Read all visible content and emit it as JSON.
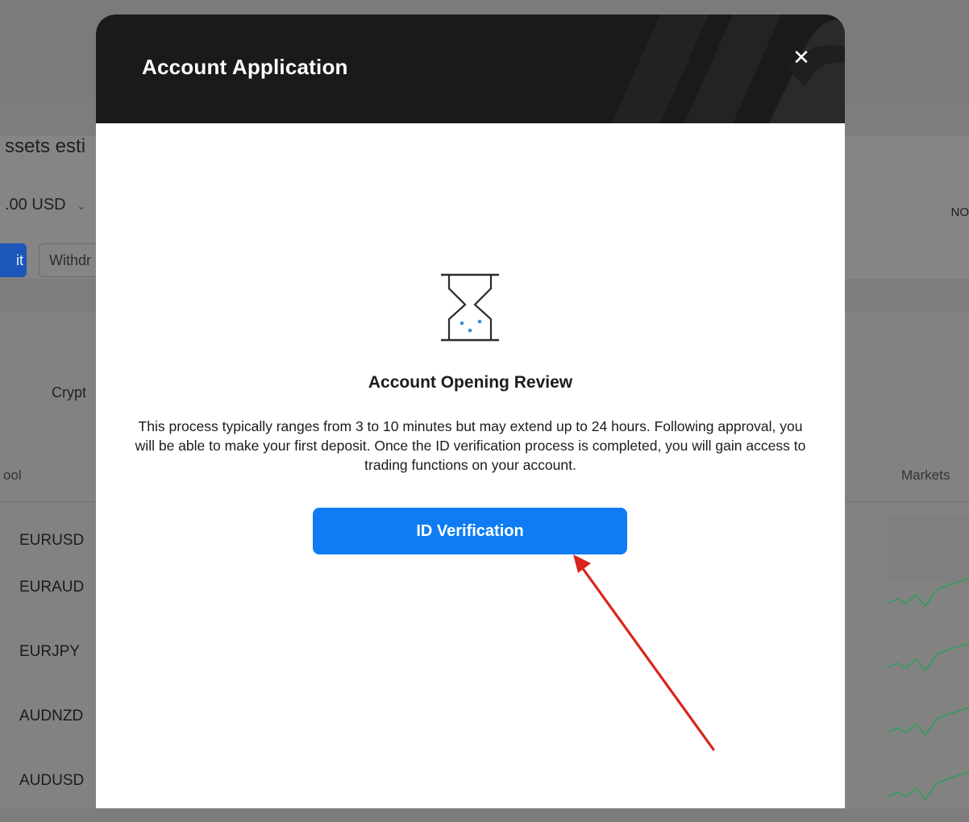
{
  "background": {
    "assets_label": "ssets esti",
    "balance_value": ".00",
    "balance_currency": "USD",
    "deposit_label": "it",
    "withdraw_label": "Withdr",
    "right_label": "NO",
    "category_tab": "Crypt",
    "columns": {
      "symbol": "ool",
      "markets": "Markets"
    },
    "rows": [
      {
        "symbol": "EURUSD"
      },
      {
        "symbol": "EURAUD"
      },
      {
        "symbol": "EURJPY"
      },
      {
        "symbol": "AUDNZD"
      },
      {
        "symbol": "AUDUSD"
      }
    ],
    "sparkline_color": "#2f9e5b"
  },
  "modal": {
    "title": "Account Application",
    "close_icon": "close-icon",
    "status_icon": "hourglass-icon",
    "status_title": "Account Opening Review",
    "status_body": "This process typically ranges from 3 to 10 minutes but may extend up to 24 hours. Following approval, you will be able to make your first deposit. Once the ID verification process is completed, you will gain access to trading functions on your account.",
    "primary_button": "ID Verification",
    "accent_color": "#0f7cf3",
    "header_color": "#1a1a1a"
  },
  "annotation": {
    "type": "arrow",
    "color": "#d8241c",
    "points_to": "ID Verification"
  }
}
